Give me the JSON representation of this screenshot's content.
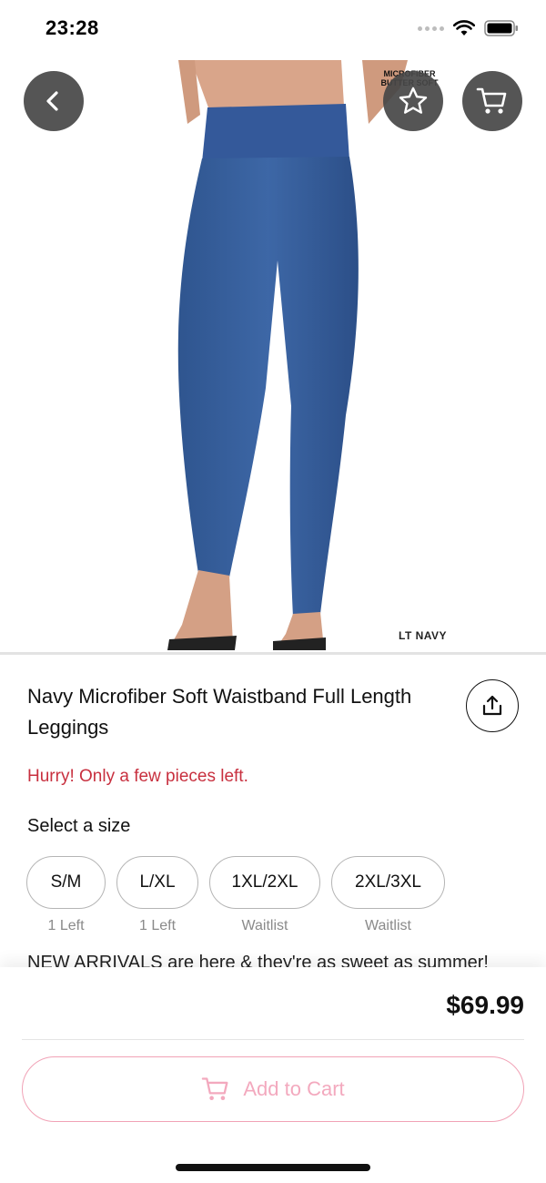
{
  "status_bar": {
    "time": "23:28"
  },
  "hero": {
    "brand_tag_line1": "MICROFIBER",
    "brand_tag_line2": "BUTTER SOFT",
    "color_tag": "LT NAVY",
    "pager": {
      "count": 3,
      "active_index": 1
    }
  },
  "icons": {
    "back": "chevron-left-icon",
    "favorite": "star-icon",
    "cart": "cart-icon",
    "share": "share-icon"
  },
  "product": {
    "title": "Navy Microfiber Soft Waistband Full Length Leggings",
    "urgency": "Hurry! Only a few pieces left.",
    "size_heading": "Select a size",
    "sizes": [
      {
        "label": "S/M",
        "note": "1 Left"
      },
      {
        "label": "L/XL",
        "note": "1 Left"
      },
      {
        "label": "1XL/2XL",
        "note": "Waitlist"
      },
      {
        "label": "2XL/3XL",
        "note": "Waitlist"
      }
    ],
    "description_preview": "NEW ARRIVALS are here & they're as sweet as summer!"
  },
  "checkout": {
    "price": "$69.99",
    "add_to_cart_label": "Add to Cart"
  },
  "colors": {
    "accent_pink": "#f3a9be",
    "urgency_red": "#c8303f",
    "legging_blue": "#3a62a0"
  }
}
